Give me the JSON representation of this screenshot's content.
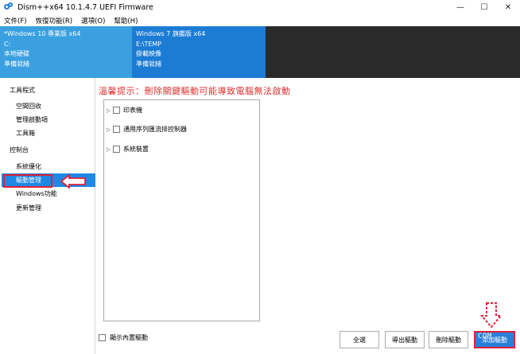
{
  "window": {
    "title": "Dism++x64 10.1.4.7 UEFI Firmware",
    "minimize_glyph": "—",
    "maximize_glyph": "☐",
    "close_glyph": "✕"
  },
  "menu": {
    "items": [
      "文件(F)",
      "恢復功能(R)",
      "選項(O)",
      "幫助(H)"
    ]
  },
  "sessions": [
    {
      "name": "*Windows 10 專業版 x64",
      "drive": "C:",
      "type": "本地硬碟",
      "status": "準備就緒"
    },
    {
      "name": "Windows 7 旗艦版 x64",
      "drive": "E:\\TEMP",
      "type": "掛載映像",
      "status": "準備就緒"
    }
  ],
  "sidebar": {
    "groups": [
      {
        "title": "工具程式",
        "items": [
          "空間回收",
          "管理啟動項",
          "工具箱"
        ]
      },
      {
        "title": "控制台",
        "items": [
          "系統優化",
          "驅動管理",
          "Windows功能",
          "更新管理"
        ]
      }
    ],
    "selected": "驅動管理"
  },
  "main": {
    "warning": "溫馨提示：刪除關鍵驅動可能導致電腦無法啟動",
    "tree_items": [
      "印表機",
      "通用序列匯流排控制器",
      "系統裝置"
    ],
    "show_builtin_label": "顯示內置驅動"
  },
  "buttons": {
    "select_all": "全選",
    "export": "導出驅動",
    "delete": "刪除驅動",
    "add": "添加驅動"
  },
  "watermark_text": "COM",
  "colors": {
    "active_session": "#3aa0e0",
    "other_session": "#1c7cd4",
    "selected_item": "#1e88e5",
    "warning": "#e03030",
    "highlight": "#e0203a"
  }
}
